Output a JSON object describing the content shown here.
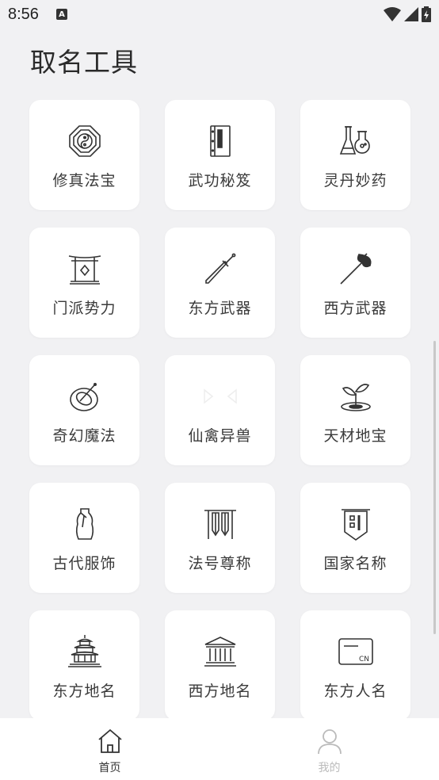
{
  "status_bar": {
    "time": "8:56",
    "notification_letter": "A"
  },
  "page": {
    "title": "取名工具"
  },
  "tools": [
    {
      "label": "修真法宝",
      "icon": "bagua-icon"
    },
    {
      "label": "武功秘笈",
      "icon": "scroll-book-icon"
    },
    {
      "label": "灵丹妙药",
      "icon": "potion-flask-icon"
    },
    {
      "label": "门派势力",
      "icon": "gate-icon"
    },
    {
      "label": "东方武器",
      "icon": "sword-icon"
    },
    {
      "label": "西方武器",
      "icon": "axe-icon"
    },
    {
      "label": "奇幻魔法",
      "icon": "magic-orb-icon"
    },
    {
      "label": "仙禽异兽",
      "icon": "beast-icon"
    },
    {
      "label": "天材地宝",
      "icon": "sprout-icon"
    },
    {
      "label": "古代服饰",
      "icon": "robe-icon"
    },
    {
      "label": "法号尊称",
      "icon": "banner-icon"
    },
    {
      "label": "国家名称",
      "icon": "flag-icon"
    },
    {
      "label": "东方地名",
      "icon": "pagoda-icon"
    },
    {
      "label": "西方地名",
      "icon": "temple-icon"
    },
    {
      "label": "东方人名",
      "icon": "id-card-icon"
    }
  ],
  "id_card_text": "CN",
  "bottom_nav": {
    "home_label": "首页",
    "mine_label": "我的"
  }
}
